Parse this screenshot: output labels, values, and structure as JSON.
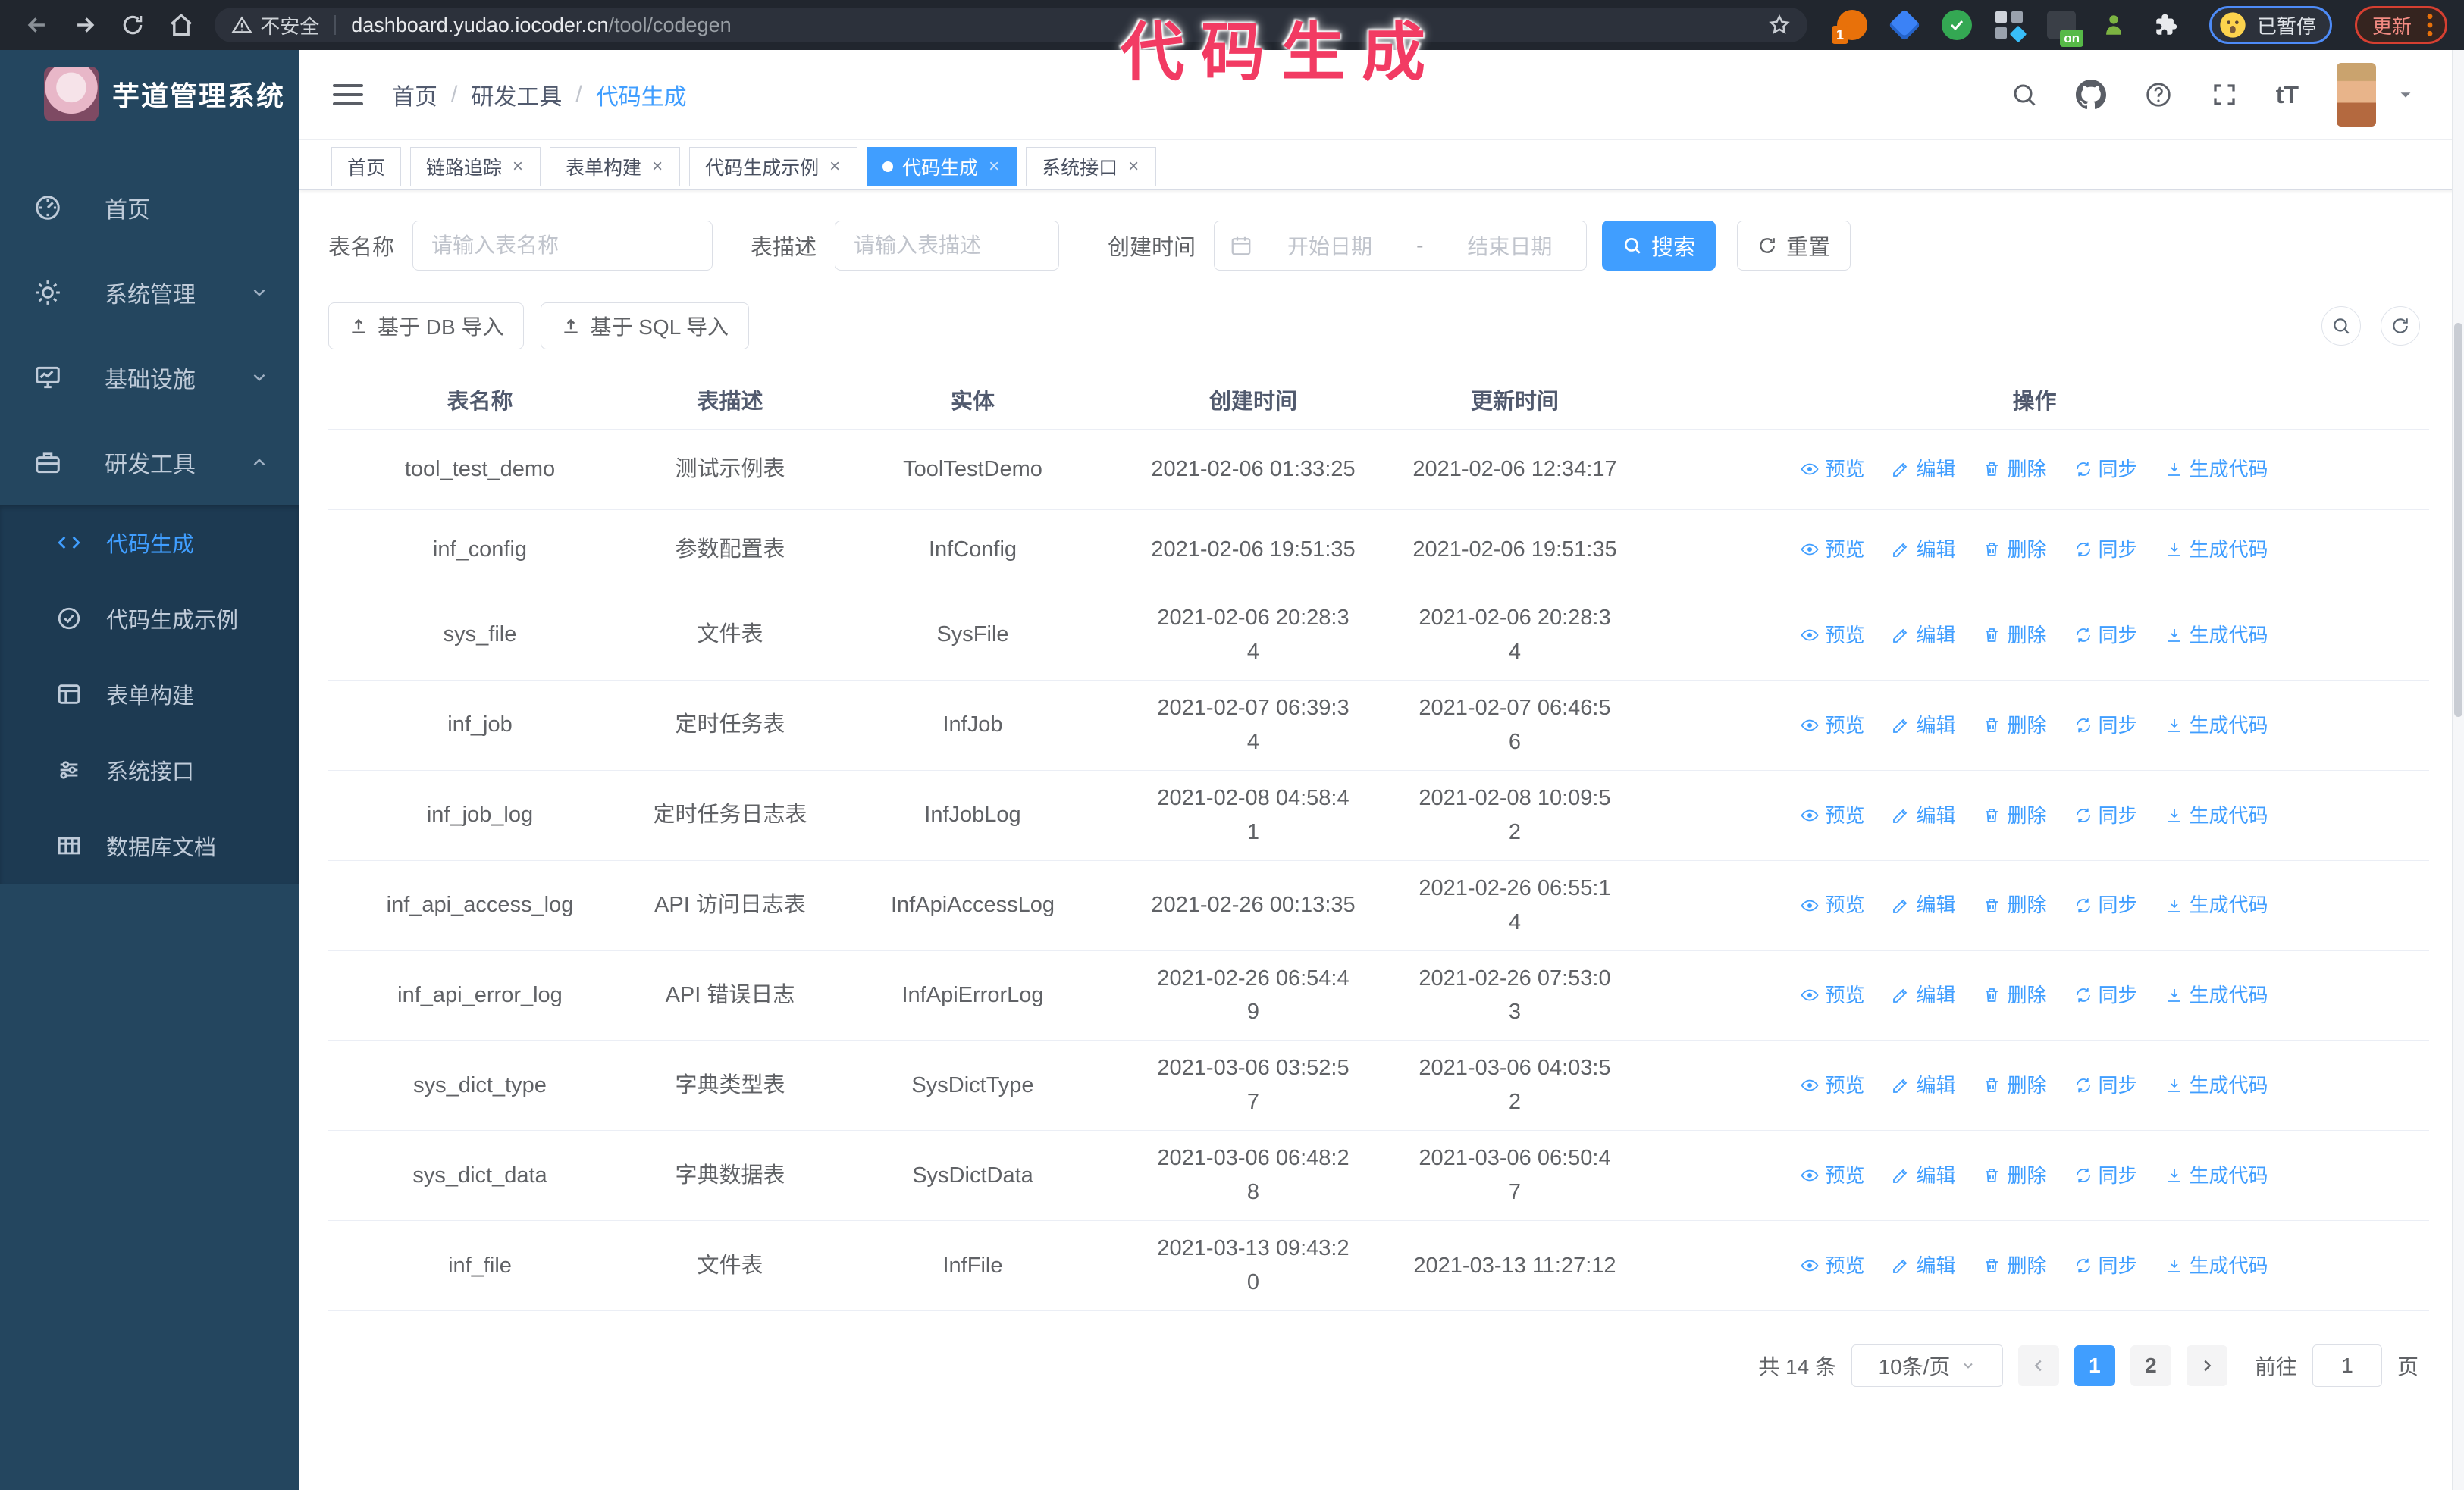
{
  "annotation": {
    "text": "代码生成",
    "color": "#f23b63"
  },
  "browser": {
    "insecure_label": "不安全",
    "url_host": "dashboard.yudao.iocoder.cn",
    "url_path": "/tool/codegen",
    "extension_count_badge": "1",
    "extension_on_badge": "on",
    "profile_status": "已暂停",
    "update_label": "更新"
  },
  "sidebar": {
    "logo_title": "芋道管理系统",
    "items": [
      {
        "label": "首页"
      },
      {
        "label": "系统管理"
      },
      {
        "label": "基础设施"
      },
      {
        "label": "研发工具"
      }
    ],
    "submenu": [
      {
        "label": "代码生成",
        "active": true
      },
      {
        "label": "代码生成示例",
        "active": false
      },
      {
        "label": "表单构建",
        "active": false
      },
      {
        "label": "系统接口",
        "active": false
      },
      {
        "label": "数据库文档",
        "active": false
      }
    ]
  },
  "header": {
    "breadcrumb": [
      "首页",
      "研发工具",
      "代码生成"
    ]
  },
  "tabs": [
    {
      "label": "首页",
      "closable": false,
      "active": false
    },
    {
      "label": "链路追踪",
      "closable": true,
      "active": false
    },
    {
      "label": "表单构建",
      "closable": true,
      "active": false
    },
    {
      "label": "代码生成示例",
      "closable": true,
      "active": false
    },
    {
      "label": "代码生成",
      "closable": true,
      "active": true
    },
    {
      "label": "系统接口",
      "closable": true,
      "active": false
    }
  ],
  "filters": {
    "name_label": "表名称",
    "name_placeholder": "请输入表名称",
    "desc_label": "表描述",
    "desc_placeholder": "请输入表描述",
    "time_label": "创建时间",
    "start_placeholder": "开始日期",
    "range_separator": "-",
    "end_placeholder": "结束日期",
    "search_label": "搜索",
    "reset_label": "重置",
    "import_db_label": "基于 DB 导入",
    "import_sql_label": "基于 SQL 导入"
  },
  "table": {
    "columns": [
      "表名称",
      "表描述",
      "实体",
      "创建时间",
      "更新时间",
      "操作"
    ],
    "actions": [
      "预览",
      "编辑",
      "删除",
      "同步",
      "生成代码"
    ],
    "rows": [
      {
        "name": "tool_test_demo",
        "desc": "测试示例表",
        "entity": "ToolTestDemo",
        "created": "2021-02-06 01:33:25",
        "updated": "2021-02-06 12:34:17",
        "created_wrap": false,
        "updated_wrap": false
      },
      {
        "name": "inf_config",
        "desc": "参数配置表",
        "entity": "InfConfig",
        "created": "2021-02-06 19:51:35",
        "updated": "2021-02-06 19:51:35",
        "created_wrap": false,
        "updated_wrap": false
      },
      {
        "name": "sys_file",
        "desc": "文件表",
        "entity": "SysFile",
        "created": "2021-02-06 20:28:34",
        "updated": "2021-02-06 20:28:34",
        "created_wrap": true,
        "updated_wrap": true
      },
      {
        "name": "inf_job",
        "desc": "定时任务表",
        "entity": "InfJob",
        "created": "2021-02-07 06:39:34",
        "updated": "2021-02-07 06:46:56",
        "created_wrap": true,
        "updated_wrap": true
      },
      {
        "name": "inf_job_log",
        "desc": "定时任务日志表",
        "entity": "InfJobLog",
        "created": "2021-02-08 04:58:41",
        "updated": "2021-02-08 10:09:52",
        "created_wrap": true,
        "updated_wrap": true
      },
      {
        "name": "inf_api_access_log",
        "desc": "API 访问日志表",
        "entity": "InfApiAccessLog",
        "created": "2021-02-26 00:13:35",
        "updated": "2021-02-26 06:55:14",
        "created_wrap": false,
        "updated_wrap": true
      },
      {
        "name": "inf_api_error_log",
        "desc": "API 错误日志",
        "entity": "InfApiErrorLog",
        "created": "2021-02-26 06:54:49",
        "updated": "2021-02-26 07:53:03",
        "created_wrap": true,
        "updated_wrap": true
      },
      {
        "name": "sys_dict_type",
        "desc": "字典类型表",
        "entity": "SysDictType",
        "created": "2021-03-06 03:52:57",
        "updated": "2021-03-06 04:03:52",
        "created_wrap": true,
        "updated_wrap": true
      },
      {
        "name": "sys_dict_data",
        "desc": "字典数据表",
        "entity": "SysDictData",
        "created": "2021-03-06 06:48:28",
        "updated": "2021-03-06 06:50:47",
        "created_wrap": true,
        "updated_wrap": true
      },
      {
        "name": "inf_file",
        "desc": "文件表",
        "entity": "InfFile",
        "created": "2021-03-13 09:43:20",
        "updated": "2021-03-13 11:27:12",
        "created_wrap": true,
        "updated_wrap": false
      }
    ]
  },
  "pagination": {
    "total_label": "共 14 条",
    "page_size": "10条/页",
    "pages": [
      "1",
      "2"
    ],
    "active_page": "1",
    "goto_label": "前往",
    "goto_value": "1",
    "page_suffix": "页"
  },
  "colors": {
    "accent": "#409eff",
    "sidebar_bg": "#24465f",
    "submenu_bg": "#1d3a52",
    "annotation": "#f23b63",
    "browser_bar": "#21262e"
  }
}
